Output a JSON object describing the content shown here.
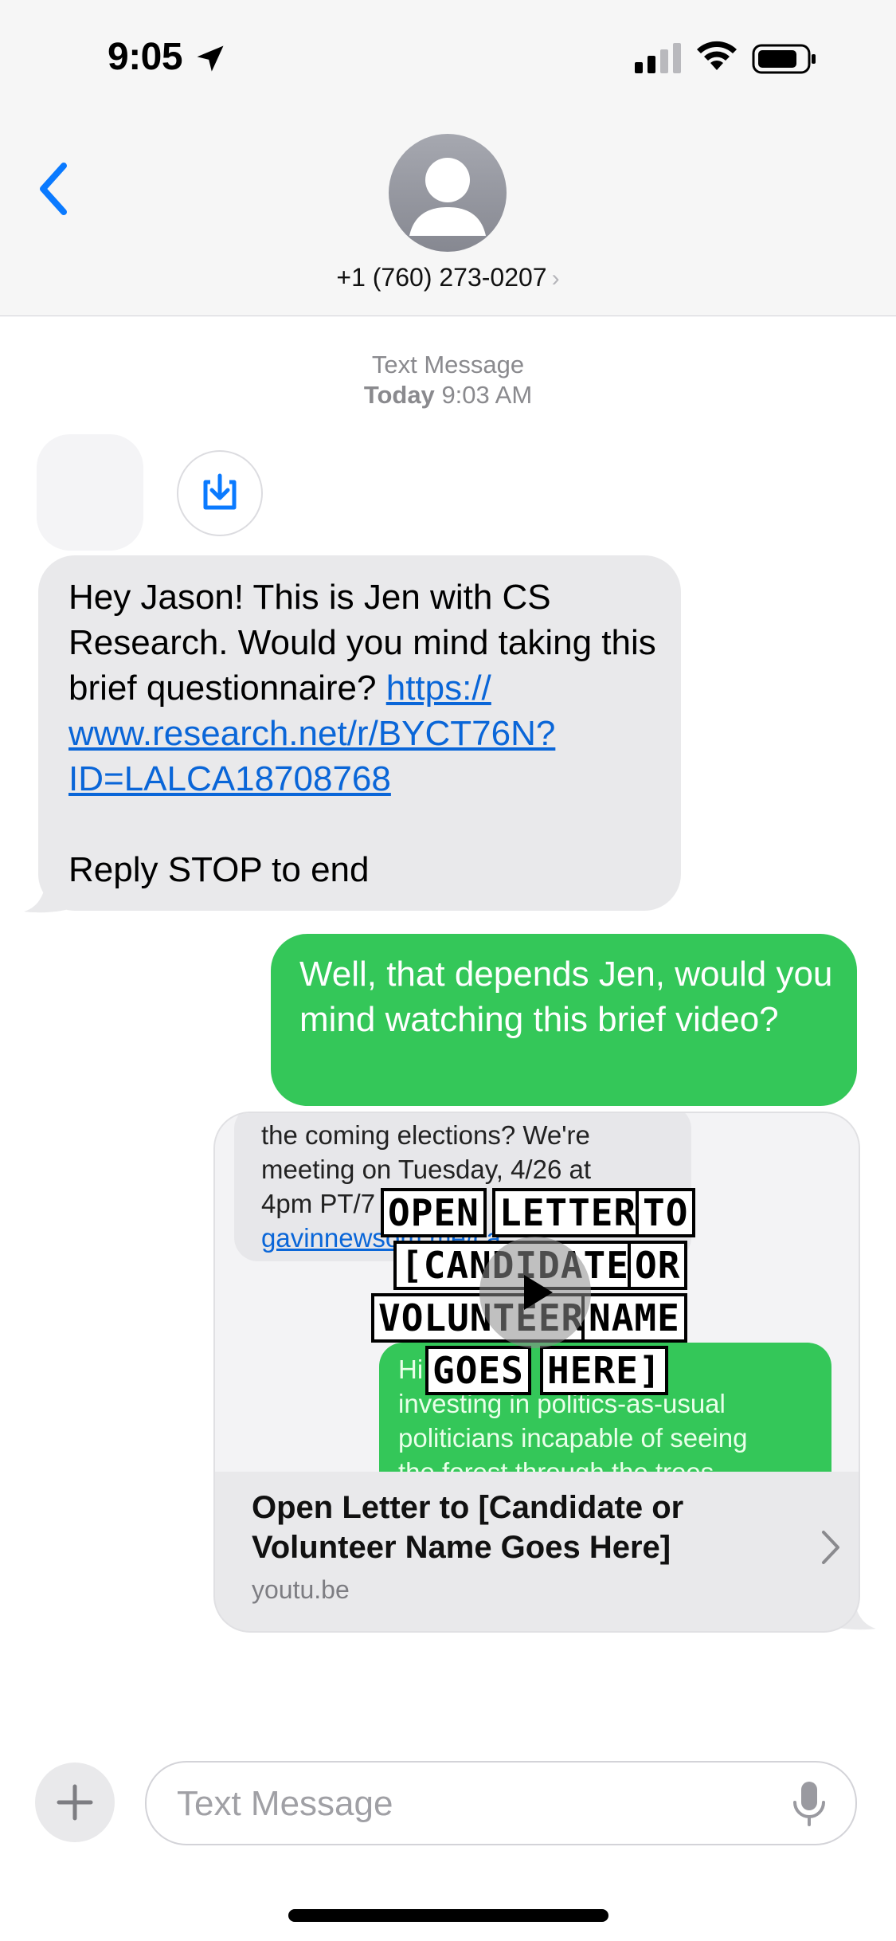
{
  "status_bar": {
    "time": "9:05"
  },
  "header": {
    "contact": "+1 (760) 273-0207",
    "contact_chevron": "›"
  },
  "timestamp": {
    "label": "Text Message",
    "day": "Today",
    "time": "9:03 AM"
  },
  "messages": {
    "incoming": {
      "text_before": "Hey Jason! This is Jen with CS Research. Would you mind taking this brief questionnaire? ",
      "link_line1": "https://",
      "link_line2": "www.research.net/r/BYCT76N?",
      "link_line3": "ID=LALCA18708768",
      "footer": "Reply STOP to end"
    },
    "outgoing": {
      "text": "Well, that depends Jen, would you mind watching this brief video?"
    }
  },
  "preview": {
    "thumb": {
      "in_line1": "the coming elections? We're",
      "in_line2": "meeting on Tuesday, 4/26 at",
      "in_line3": "4pm PT/7",
      "in_link": "gavinnewsom.me/ca",
      "out_line1": "Hi",
      "out_line1b": "done",
      "out_line2": "investing in politics-as-usual",
      "out_line3": "politicians incapable of seeing",
      "out_line4": "the forest through the trees",
      "overlay": [
        "OPEN",
        "LETTER",
        "TO",
        "[CANDIDATE",
        "OR",
        "VOLUNTEER",
        "NAME",
        "GOES",
        "HERE]"
      ]
    },
    "title": "Open Letter to [Candidate or Volunteer Name Goes Here]",
    "domain": "youtu.be"
  },
  "compose": {
    "placeholder": "Text Message"
  },
  "colors": {
    "outgoing": "#34c759",
    "incoming": "#e9e9eb",
    "link": "#0a66d8",
    "accent": "#0a7aff"
  }
}
